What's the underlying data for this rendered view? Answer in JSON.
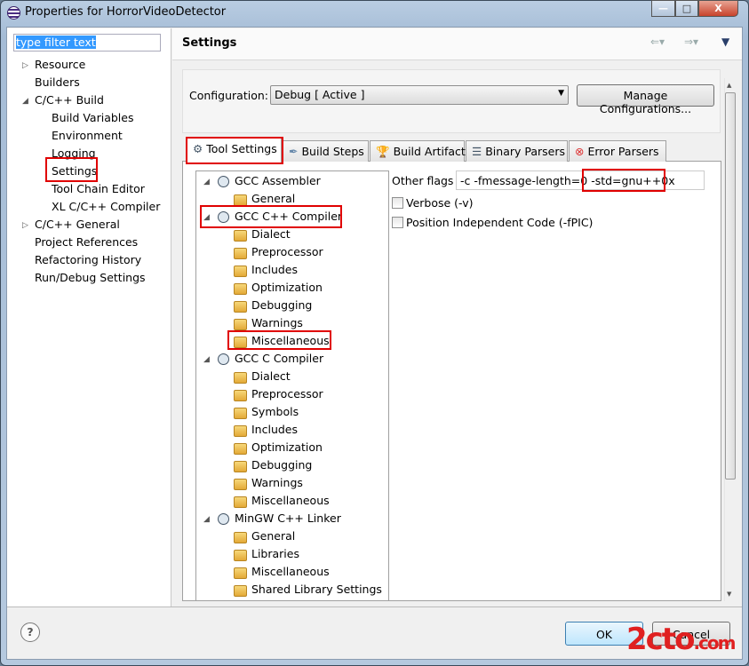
{
  "window": {
    "title": "Properties for HorrorVideoDetector",
    "buttons": [
      "minimize",
      "maximize",
      "close"
    ]
  },
  "left": {
    "filter_placeholder": "type filter text",
    "items": [
      {
        "label": "Resource",
        "level": 0,
        "arrow": "collapsed"
      },
      {
        "label": "Builders",
        "level": 0
      },
      {
        "label": "C/C++ Build",
        "level": 0,
        "arrow": "expanded"
      },
      {
        "label": "Build Variables",
        "level": 1
      },
      {
        "label": "Environment",
        "level": 1
      },
      {
        "label": "Logging",
        "level": 1
      },
      {
        "label": "Settings",
        "level": 1,
        "selected": true
      },
      {
        "label": "Tool Chain Editor",
        "level": 1
      },
      {
        "label": "XL C/C++ Compiler",
        "level": 1
      },
      {
        "label": "C/C++ General",
        "level": 0,
        "arrow": "collapsed"
      },
      {
        "label": "Project References",
        "level": 0
      },
      {
        "label": "Refactoring History",
        "level": 0
      },
      {
        "label": "Run/Debug Settings",
        "level": 0
      }
    ]
  },
  "header": {
    "title": "Settings"
  },
  "config": {
    "label": "Configuration:",
    "value": "Debug  [ Active ]",
    "manage_label": "Manage Configurations..."
  },
  "tabs": [
    {
      "label": "Tool Settings",
      "icon": "tool-settings-icon",
      "selected": true
    },
    {
      "label": "Build Steps",
      "icon": "build-steps-icon"
    },
    {
      "label": "Build Artifact",
      "icon": "build-artifact-icon"
    },
    {
      "label": "Binary Parsers",
      "icon": "binary-parsers-icon"
    },
    {
      "label": "Error Parsers",
      "icon": "error-parsers-icon"
    }
  ],
  "tool_tree": [
    {
      "label": "GCC Assembler",
      "tool": true
    },
    {
      "label": "General"
    },
    {
      "label": "GCC C++ Compiler",
      "tool": true
    },
    {
      "label": "Dialect"
    },
    {
      "label": "Preprocessor"
    },
    {
      "label": "Includes"
    },
    {
      "label": "Optimization"
    },
    {
      "label": "Debugging"
    },
    {
      "label": "Warnings"
    },
    {
      "label": "Miscellaneous",
      "selected": true
    },
    {
      "label": "GCC C Compiler",
      "tool": true
    },
    {
      "label": "Dialect"
    },
    {
      "label": "Preprocessor"
    },
    {
      "label": "Symbols"
    },
    {
      "label": "Includes"
    },
    {
      "label": "Optimization"
    },
    {
      "label": "Debugging"
    },
    {
      "label": "Warnings"
    },
    {
      "label": "Miscellaneous"
    },
    {
      "label": "MinGW C++ Linker",
      "tool": true
    },
    {
      "label": "General"
    },
    {
      "label": "Libraries"
    },
    {
      "label": "Miscellaneous"
    },
    {
      "label": "Shared Library Settings"
    }
  ],
  "misc": {
    "other_flags_label": "Other flags",
    "other_flags_value": "-c -fmessage-length=0 -std=gnu++0x",
    "verbose_label": "Verbose (-v)",
    "verbose_checked": false,
    "fpic_label": "Position Independent Code (-fPIC)",
    "fpic_checked": false
  },
  "footer": {
    "ok_label": "OK",
    "cancel_label": "Cancel"
  },
  "watermark": "2cto.com 红黑联盟",
  "colors": {
    "highlight_red": "#e00000",
    "selection_blue": "#3399ff"
  }
}
